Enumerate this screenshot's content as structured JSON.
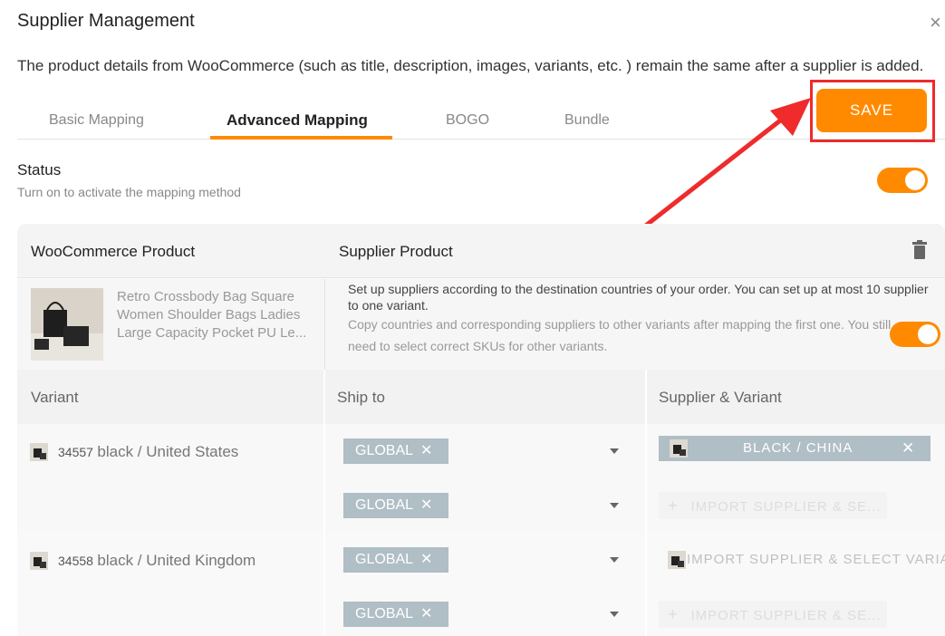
{
  "modal": {
    "title": "Supplier Management",
    "close_glyph": "×",
    "description": "The product details from WooCommerce (such as title, description, images, variants, etc. ) remain the same after a supplier is added."
  },
  "tabs": [
    {
      "label": "Basic Mapping",
      "active": false
    },
    {
      "label": "Advanced Mapping",
      "active": true
    },
    {
      "label": "BOGO",
      "active": false
    },
    {
      "label": "Bundle",
      "active": false
    }
  ],
  "save_label": "SAVE",
  "status": {
    "label": "Status",
    "sub": "Turn on to activate the mapping method",
    "enabled": true
  },
  "table": {
    "col_woo": "WooCommerce Product",
    "col_supplier": "Supplier Product",
    "product_title": "Retro Crossbody Bag Square Women Shoulder Bags Ladies Large Capacity Pocket PU Le...",
    "setup_text": "Set up suppliers according to the destination countries of your order. You can set up at most 10 supplier to one variant.",
    "copy_text": "Copy countries and corresponding suppliers to other variants after mapping the first one. You still need to select correct SKUs for other variants.",
    "copy_enabled": true,
    "col_variant": "Variant",
    "col_ship": "Ship to",
    "col_supvar": "Supplier & Variant"
  },
  "variants": [
    {
      "id": "34557",
      "name": "black / United States",
      "ship_1": "GLOBAL",
      "ship_2": "GLOBAL",
      "supplier_1": "BLACK / CHINA",
      "supplier_2": "IMPORT SUPPLIER & SE..."
    },
    {
      "id": "34558",
      "name": "black / United Kingdom",
      "ship_1": "GLOBAL",
      "ship_2": "GLOBAL",
      "supplier_1": "IMPORT SUPPLIER & SELECT VARIAN",
      "supplier_2": "IMPORT SUPPLIER & SE..."
    }
  ],
  "colors": {
    "accent": "#ff8a00",
    "highlight": "#ef2b2b",
    "tag": "#b0bec5"
  }
}
